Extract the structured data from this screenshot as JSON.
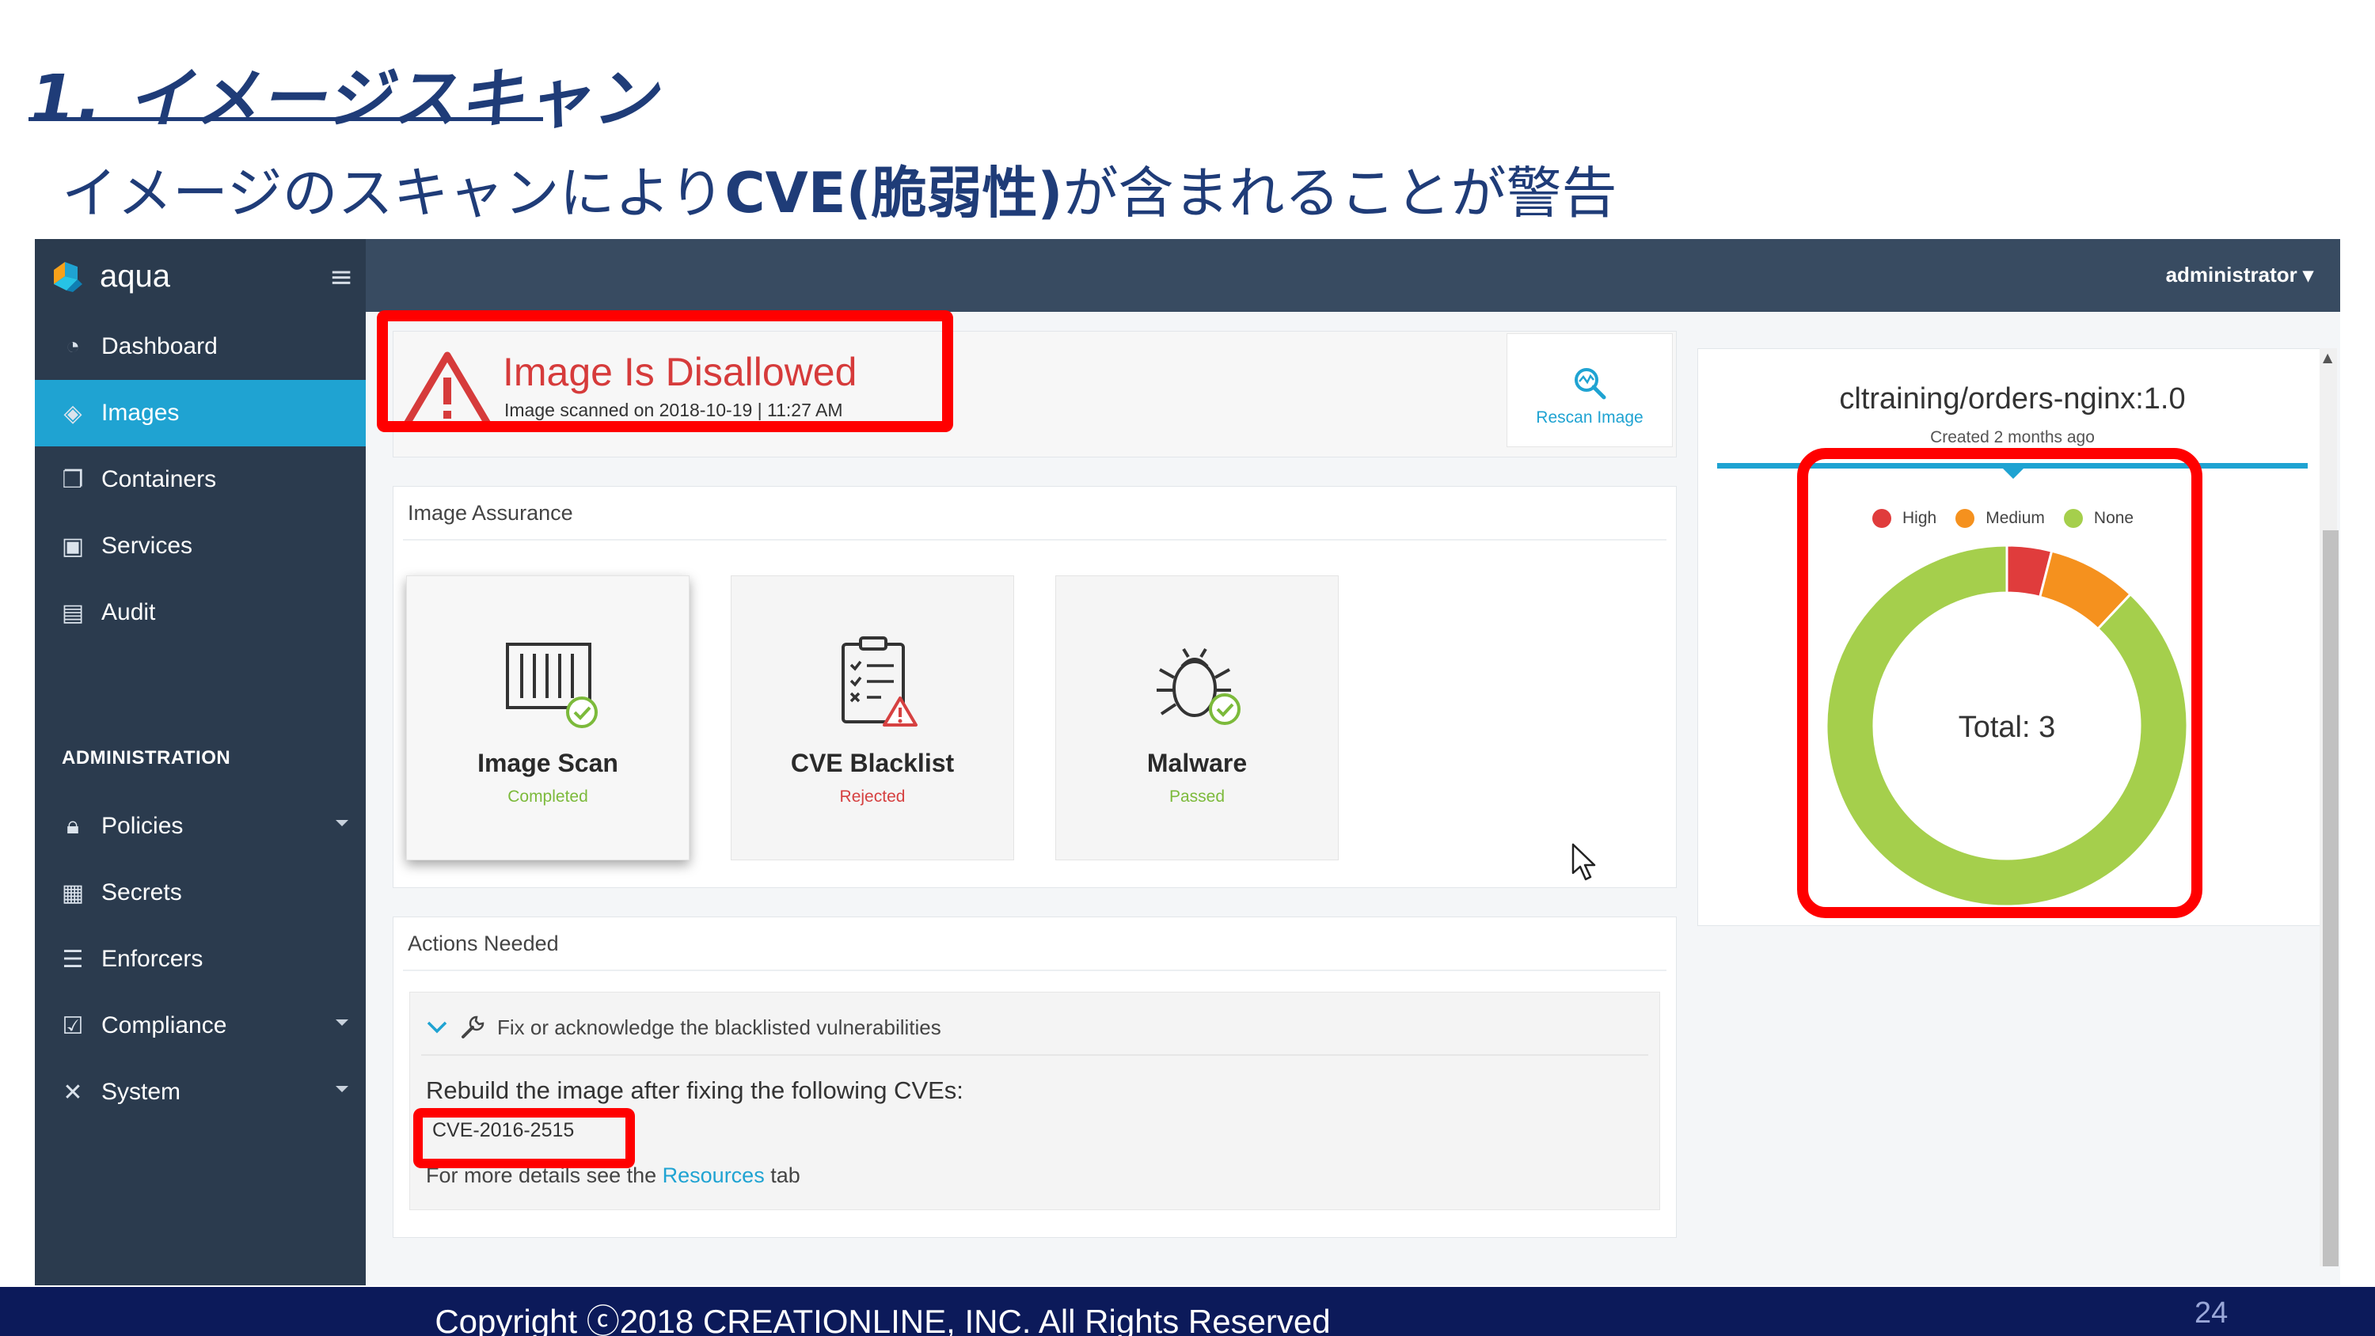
{
  "slide": {
    "title": "1. イメージスキャン",
    "subtitle_pre": "イメージのスキャンにより",
    "subtitle_bold": "CVE(脆弱性)",
    "subtitle_post": "が含まれることが警告"
  },
  "app": {
    "brand": "aqua",
    "user_menu": "administrator ▾",
    "nav": [
      {
        "label": "Dashboard",
        "icon": "dashboard-icon"
      },
      {
        "label": "Images",
        "icon": "layers-icon",
        "active": true
      },
      {
        "label": "Containers",
        "icon": "containers-icon"
      },
      {
        "label": "Services",
        "icon": "services-icon"
      },
      {
        "label": "Audit",
        "icon": "audit-icon"
      }
    ],
    "admin_section": "ADMINISTRATION",
    "admin_nav": [
      {
        "label": "Policies",
        "icon": "lock-icon",
        "has_submenu": true
      },
      {
        "label": "Secrets",
        "icon": "secrets-icon"
      },
      {
        "label": "Enforcers",
        "icon": "enforcers-icon"
      },
      {
        "label": "Compliance",
        "icon": "compliance-icon",
        "has_submenu": true
      },
      {
        "label": "System",
        "icon": "system-tools-icon",
        "has_submenu": true
      }
    ]
  },
  "status": {
    "title": "Image Is Disallowed",
    "scanned": "Image scanned on 2018-10-19 | 11:27 AM",
    "rescan_label": "Rescan Image"
  },
  "assurance": {
    "header": "Image Assurance",
    "checks": [
      {
        "title": "Image Scan",
        "status": "Completed",
        "state": "ok"
      },
      {
        "title": "CVE Blacklist",
        "status": "Rejected",
        "state": "bad"
      },
      {
        "title": "Malware",
        "status": "Passed",
        "state": "ok"
      }
    ]
  },
  "actions": {
    "header": "Actions Needed",
    "item": "Fix or acknowledge the blacklisted vulnerabilities",
    "rebuild": "Rebuild the image after fixing the following CVEs:",
    "cve": "CVE-2016-2515",
    "details_pre": "For more details see the ",
    "details_link": "Resources",
    "details_post": " tab"
  },
  "image_info": {
    "name": "cltraining/orders-nginx:1.0",
    "created": "Created 2 months ago"
  },
  "chart_data": {
    "type": "pie",
    "legend": [
      "High",
      "Medium",
      "None"
    ],
    "colors": {
      "High": "#e03c3c",
      "Medium": "#f5911e",
      "None": "#a5cf4c"
    },
    "slices": [
      {
        "name": "High",
        "fraction": 0.04
      },
      {
        "name": "Medium",
        "fraction": 0.08
      },
      {
        "name": "None",
        "fraction": 0.88
      }
    ],
    "center_label": "Total: 3",
    "legend_position": "top"
  },
  "footer": {
    "copyright": "Copyright ⓒ2018 CREATIONLINE, INC. All Rights Reserved",
    "page": "24"
  }
}
